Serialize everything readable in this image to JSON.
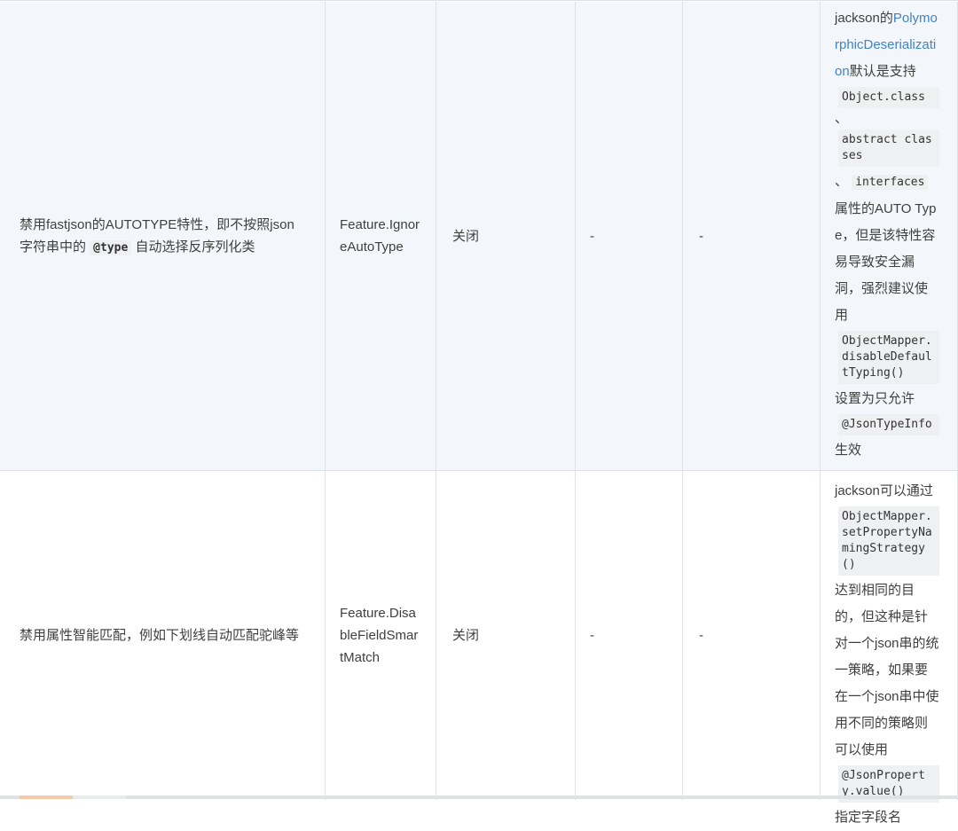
{
  "rows": [
    {
      "desc_parts": [
        "禁用fastjson的AUTOTYPE特性，即不按照json字符串中的 ",
        "@type",
        " 自动选择反序列化类"
      ],
      "feature": "Feature.IgnoreAutoType",
      "default": "关闭",
      "col4": "-",
      "col5": "-",
      "note": {
        "t1": "jackson的",
        "link": "PolymorphicDeserialization",
        "t2": "默认是支持",
        "c1": "Object.class",
        "sep1": "、",
        "c2": "abstract classes",
        "sep2": "、",
        "c3": "interfaces",
        "t3": "属性的AUTO Type，但是该特性容易导致安全漏洞，强烈建议使用",
        "c4": "ObjectMapper.disableDefaultTyping()",
        "t4": "设置为只允许",
        "c5": "@JsonTypeInfo",
        "t5": "生效"
      }
    },
    {
      "desc": "禁用属性智能匹配，例如下划线自动匹配驼峰等",
      "feature": "Feature.DisableFieldSmartMatch",
      "default": "关闭",
      "col4": "-",
      "col5": "-",
      "note": {
        "t1": "jackson可以通过",
        "c1": "ObjectMapper.setPropertyNamingStrategy()",
        "t2": "达到相同的目的，但这种是针对一个json串的统一策略，如果要在一个json串中使用不同的策略则可以使用",
        "c2": "@JsonProperty.value()",
        "t3": "指定字段名"
      }
    }
  ],
  "colors": {
    "row_alt": "#f3f6fa",
    "border": "#dfe2e5",
    "link": "#4183c4",
    "code_bg": "#eef0f2"
  }
}
